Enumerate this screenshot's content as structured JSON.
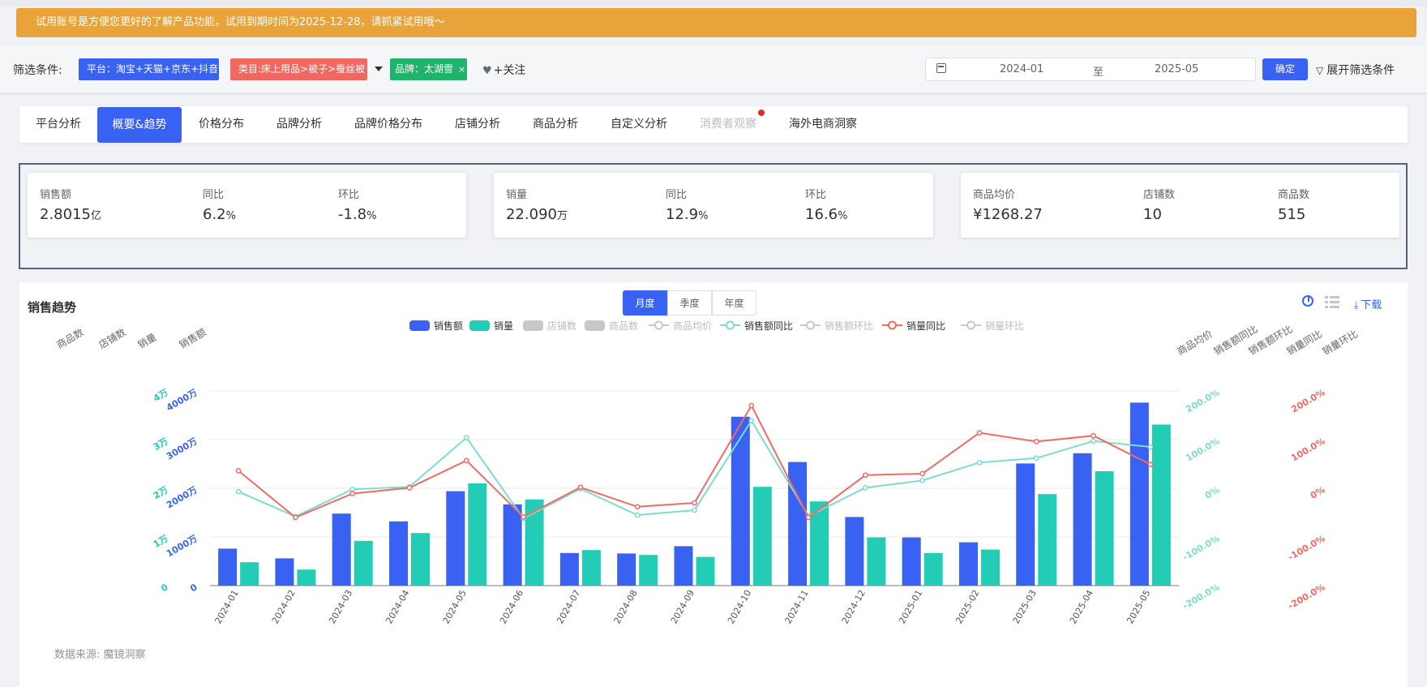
{
  "banner": {
    "text": "试用账号是方便您更好的了解产品功能，试用到期时间为2025-12-28，请抓紧试用哦～"
  },
  "filter": {
    "label": "筛选条件:",
    "platform_tag": "平台：淘宝+天猫+京东+抖音",
    "category_tag": "类目:床上用品>被子>蚕丝被",
    "brand_tag": "品牌：太湖雪",
    "brand_close": "×",
    "follow_label": "+关注",
    "date_start": "2024-01",
    "date_separator": "至",
    "date_end": "2025-05",
    "confirm_label": "确定",
    "expand_label": "展开筛选条件"
  },
  "tabs": [
    {
      "label": "平台分析",
      "state": "normal"
    },
    {
      "label": "概要&趋势",
      "state": "active"
    },
    {
      "label": "价格分布",
      "state": "normal"
    },
    {
      "label": "品牌分析",
      "state": "normal"
    },
    {
      "label": "品牌价格分布",
      "state": "normal"
    },
    {
      "label": "店铺分析",
      "state": "normal"
    },
    {
      "label": "商品分析",
      "state": "normal"
    },
    {
      "label": "自定义分析",
      "state": "normal"
    },
    {
      "label": "消费者观察",
      "state": "disabled"
    },
    {
      "label": "海外电商洞察",
      "state": "normal"
    }
  ],
  "kpis": {
    "sales": {
      "label": "销售额",
      "value": "2.8015",
      "unit": "亿"
    },
    "sales_yoy": {
      "label": "同比",
      "value": "6.2",
      "unit": "%"
    },
    "sales_mom": {
      "label": "环比",
      "value": "-1.8",
      "unit": "%"
    },
    "volume": {
      "label": "销量",
      "value": "22.090",
      "unit": "万"
    },
    "volume_yoy": {
      "label": "同比",
      "value": "12.9",
      "unit": "%"
    },
    "volume_mom": {
      "label": "环比",
      "value": "16.6",
      "unit": "%"
    },
    "avg_price": {
      "label": "商品均价",
      "value": "¥1268.27"
    },
    "stores": {
      "label": "店铺数",
      "value": "10"
    },
    "products": {
      "label": "商品数",
      "value": "515"
    }
  },
  "chart_section": {
    "title": "销售趋势",
    "periods": [
      "月度",
      "季度",
      "年度"
    ],
    "active_period": "月度",
    "download_label": "下载",
    "source": "数据来源: 魔镜洞察"
  },
  "colors": {
    "sales": "#3a62f2",
    "volume": "#23ccb4",
    "sales_yoy": "#7fdccb",
    "volume_yoy": "#ee6b67",
    "disabled": "#c8c8c8",
    "accent": "#3a62f2",
    "banner": "#e9a33b"
  },
  "chart_data": {
    "type": "bar",
    "categories": [
      "2024-01",
      "2024-02",
      "2024-03",
      "2024-04",
      "2024-05",
      "2024-06",
      "2024-07",
      "2024-08",
      "2024-09",
      "2024-10",
      "2024-11",
      "2024-12",
      "2025-01",
      "2025-02",
      "2025-03",
      "2025-04",
      "2025-05"
    ],
    "legend": [
      {
        "name": "销售额",
        "kind": "bar",
        "active": true
      },
      {
        "name": "销量",
        "kind": "bar",
        "active": true
      },
      {
        "name": "店铺数",
        "kind": "bar",
        "active": false
      },
      {
        "name": "商品数",
        "kind": "bar",
        "active": false
      },
      {
        "name": "商品均价",
        "kind": "line",
        "active": false
      },
      {
        "name": "销售额同比",
        "kind": "line",
        "active": true
      },
      {
        "name": "销售额环比",
        "kind": "line",
        "active": false
      },
      {
        "name": "销量同比",
        "kind": "line",
        "active": true
      },
      {
        "name": "销量环比",
        "kind": "line",
        "active": false
      }
    ],
    "left_axis_names": [
      "商品数",
      "店铺数",
      "销量",
      "销售额"
    ],
    "right_axis_names": [
      "商品均价",
      "销售额同比",
      "销售额环比",
      "销量同比",
      "销量环比"
    ],
    "sales_axis": {
      "ticks": [
        "0",
        "1000万",
        "2000万",
        "3000万",
        "4000万"
      ],
      "ylim": [
        0,
        40000000
      ]
    },
    "volume_axis": {
      "ticks": [
        "0",
        "1万",
        "2万",
        "3万",
        "4万"
      ],
      "ylim": [
        0,
        40000
      ]
    },
    "pct_axis": {
      "ticks": [
        "-200.0%",
        "-100.0%",
        "0%",
        "100.0%",
        "200.0%"
      ],
      "ylim": [
        -200,
        200
      ]
    },
    "series": [
      {
        "name": "销售额",
        "axis": "sales",
        "values": [
          7600000,
          5600000,
          14800000,
          13200000,
          19400000,
          16700000,
          6700000,
          6600000,
          8100000,
          34700000,
          25400000,
          14100000,
          9900000,
          8900000,
          25100000,
          27200000,
          37600000
        ]
      },
      {
        "name": "销量",
        "axis": "volume",
        "values": [
          4800,
          3300,
          9200,
          10800,
          21000,
          17700,
          7300,
          6300,
          5900,
          20300,
          17300,
          9900,
          6700,
          7400,
          18800,
          23500,
          33100
        ]
      },
      {
        "name": "销售额同比",
        "axis": "pct",
        "values": [
          -7,
          -58,
          -2,
          3,
          104,
          -62,
          -1,
          -55,
          -45,
          139,
          -57,
          1,
          16,
          53,
          62,
          97,
          85
        ]
      },
      {
        "name": "销量同比",
        "axis": "pct",
        "values": [
          36,
          -60,
          -11,
          1,
          57,
          -59,
          2,
          -38,
          -30,
          170,
          -60,
          27,
          30,
          114,
          96,
          108,
          49
        ]
      }
    ]
  }
}
